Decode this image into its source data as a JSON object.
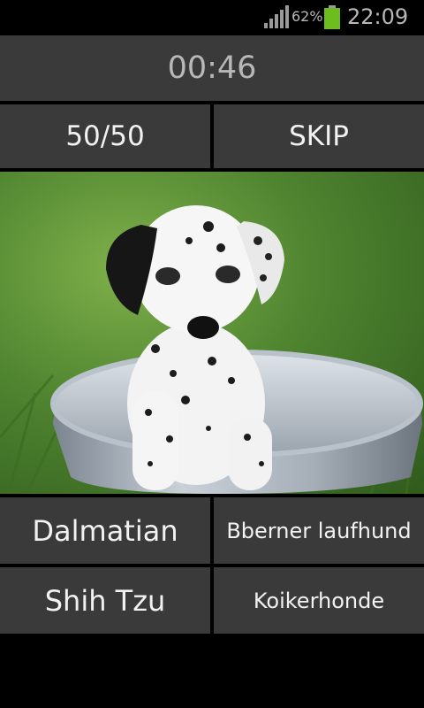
{
  "status_bar": {
    "battery_percent": "62%",
    "time": "22:09",
    "battery_color": "#6dbd1e",
    "icons": [
      "signal-icon",
      "battery-icon"
    ]
  },
  "game": {
    "timer": "00:46",
    "lifeline_label": "50/50",
    "skip_label": "SKIP",
    "photo_subject": "dalmatian puppy in a metal tub",
    "answers": [
      "Dalmatian",
      "Bberner laufhund",
      "Shih Tzu",
      "Koikerhonde"
    ]
  }
}
